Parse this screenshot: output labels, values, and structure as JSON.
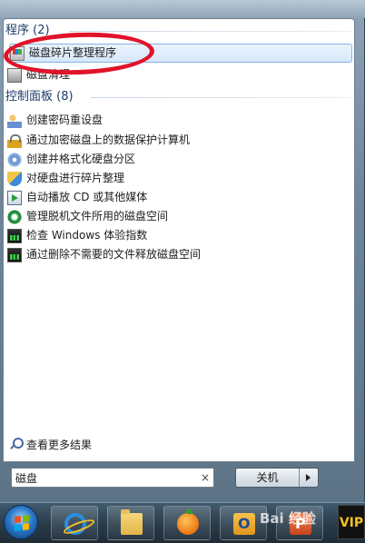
{
  "programs": {
    "header": "程序 (2)",
    "items": [
      {
        "label": "磁盘碎片整理程序",
        "icon": "disk-defrag-icon",
        "selected": true
      },
      {
        "label": "磁盘清理",
        "icon": "disk-cleanup-icon",
        "selected": false
      }
    ]
  },
  "control_panel": {
    "header": "控制面板 (8)",
    "items": [
      {
        "label": "创建密码重设盘",
        "icon": "user-icon"
      },
      {
        "label": "通过加密磁盘上的数据保护计算机",
        "icon": "bitlocker-icon"
      },
      {
        "label": "创建并格式化硬盘分区",
        "icon": "disk-management-icon"
      },
      {
        "label": "对硬盘进行碎片整理",
        "icon": "admin-tools-icon"
      },
      {
        "label": "自动播放 CD 或其他媒体",
        "icon": "autoplay-icon"
      },
      {
        "label": "管理脱机文件所用的磁盘空间",
        "icon": "sync-center-icon"
      },
      {
        "label": "检查 Windows 体验指数",
        "icon": "performance-icon"
      },
      {
        "label": "通过删除不需要的文件释放磁盘空间",
        "icon": "performance-icon"
      }
    ]
  },
  "more_results": "查看更多结果",
  "search": {
    "value": "磁盘",
    "clear": "×"
  },
  "shutdown": {
    "label": "关机"
  },
  "taskbar": {
    "items": [
      {
        "name": "internet-explorer-icon"
      },
      {
        "name": "windows-explorer-icon"
      },
      {
        "name": "orange-app-icon"
      },
      {
        "name": "outlook-icon"
      },
      {
        "name": "powerpoint-icon"
      }
    ],
    "vip": "VIP"
  },
  "watermark": "Bai 经验",
  "colors": {
    "annotation": "#e0132a",
    "header_text": "#1e3a6a",
    "selection_border": "#86b4e7"
  }
}
